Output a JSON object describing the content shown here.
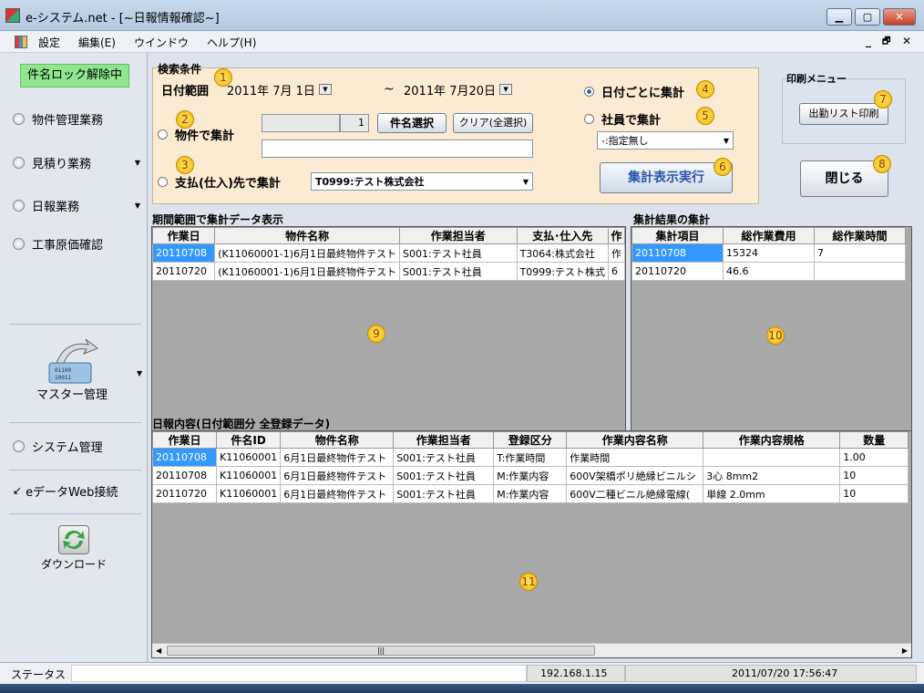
{
  "window": {
    "title": "e-システム.net - [~日報情報確認~]",
    "btn_min": "▁",
    "btn_max": "▢",
    "btn_close": "✕"
  },
  "menu": {
    "items": [
      "設定",
      "編集(E)",
      "ウインドウ",
      "ヘルプ(H)"
    ],
    "mdi_min": "_",
    "mdi_restore": "🗗",
    "mdi_close": "✕"
  },
  "sidebar": {
    "lock_status": "件名ロック解除中",
    "items": [
      "物件管理業務",
      "見積り業務",
      "日報業務",
      "工事原価確認"
    ],
    "master": "マスター管理",
    "system": "システム管理",
    "web": "eデータWeb接続",
    "download": "ダウンロード"
  },
  "search": {
    "title": "検索条件",
    "date_label": "日付範囲",
    "date_from": "2011年 7月 1日",
    "tilde": "~",
    "date_to": "2011年 7月20日",
    "opt_property": "物件で集計",
    "property_code": "",
    "property_count": "1",
    "btn_select": "件名選択",
    "btn_clear": "クリア(全選択)",
    "property_name": "",
    "opt_payee": "支払(仕入)先で集計",
    "payee_value": "T0999:テスト株式会社",
    "opt_date": "日付ごとに集計",
    "opt_employee": "社員で集計",
    "employee_value": "-:指定無し",
    "btn_execute": "集計表示実行"
  },
  "print_menu": {
    "title": "印刷メニュー",
    "btn_attendance": "出勤リスト印刷"
  },
  "btn_close": "閉じる",
  "badges": [
    "1",
    "2",
    "3",
    "4",
    "5",
    "6",
    "7",
    "8",
    "9",
    "10",
    "11"
  ],
  "period_grid": {
    "title": "期間範囲で集計データ表示",
    "headers": [
      "作業日",
      "物件名称",
      "作業担当者",
      "支払･仕入先",
      "作"
    ],
    "rows": [
      [
        "20110708",
        "(K11060001-1)6月1日最終物件テスト",
        "S001:テスト社員",
        "T3064:株式会社",
        "作"
      ],
      [
        "20110720",
        "(K11060001-1)6月1日最終物件テスト",
        "S001:テスト社員",
        "T0999:テスト株式",
        "6"
      ]
    ]
  },
  "summary_grid": {
    "title": "集計結果の集計",
    "headers": [
      "集計項目",
      "総作業費用",
      "総作業時間"
    ],
    "rows": [
      [
        "20110708",
        "15324",
        "7"
      ],
      [
        "20110720",
        "46.6",
        ""
      ]
    ]
  },
  "daily_grid": {
    "title": "日報内容(日付範囲分 全登録データ)",
    "headers": [
      "作業日",
      "件名ID",
      "物件名称",
      "作業担当者",
      "登録区分",
      "作業内容名称",
      "作業内容規格",
      "数量"
    ],
    "rows": [
      [
        "20110708",
        "K11060001",
        "6月1日最終物件テスト",
        "S001:テスト社員",
        "T:作業時間",
        "作業時間",
        "",
        "1.00"
      ],
      [
        "20110708",
        "K11060001",
        "6月1日最終物件テスト",
        "S001:テスト社員",
        "M:作業内容",
        "600V架橋ポリ絶縁ビニルシ",
        "3心 8mm2",
        "10"
      ],
      [
        "20110720",
        "K11060001",
        "6月1日最終物件テスト",
        "S001:テスト社員",
        "M:作業内容",
        "600V二種ビニル絶縁電線(",
        "単線 2.0mm",
        "10"
      ]
    ]
  },
  "status": {
    "label": "ステータス",
    "ip": "192.168.1.15",
    "datetime": "2011/07/20 17:56:47"
  },
  "scroll_grip": "|||",
  "arrow_left": "◀",
  "arrow_right": "▶",
  "dropdown_arrow": "▼"
}
